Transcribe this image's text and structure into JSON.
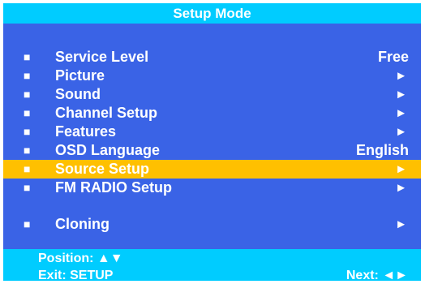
{
  "title": "Setup Mode",
  "bullet_glyph": "■",
  "arrow_glyph": "►",
  "menu": [
    {
      "label": "Service Level",
      "value": "Free"
    },
    {
      "label": "Picture",
      "value": "►"
    },
    {
      "label": "Sound",
      "value": "►"
    },
    {
      "label": "Channel Setup",
      "value": "►"
    },
    {
      "label": "Features",
      "value": "►"
    },
    {
      "label": "OSD Language",
      "value": "English"
    },
    {
      "label": "Source Setup",
      "value": "►",
      "selected": true
    },
    {
      "label": "FM RADIO Setup",
      "value": "►"
    },
    {
      "label": "Cloning",
      "value": "►"
    }
  ],
  "footer": {
    "position": "Position: ▲▼",
    "exit": "Exit: SETUP",
    "next": "Next: ◄►"
  },
  "colors": {
    "background": "#3a63e6",
    "title_bar": "#00ccff",
    "highlight": "#ffc000",
    "text": "#ffffff"
  }
}
